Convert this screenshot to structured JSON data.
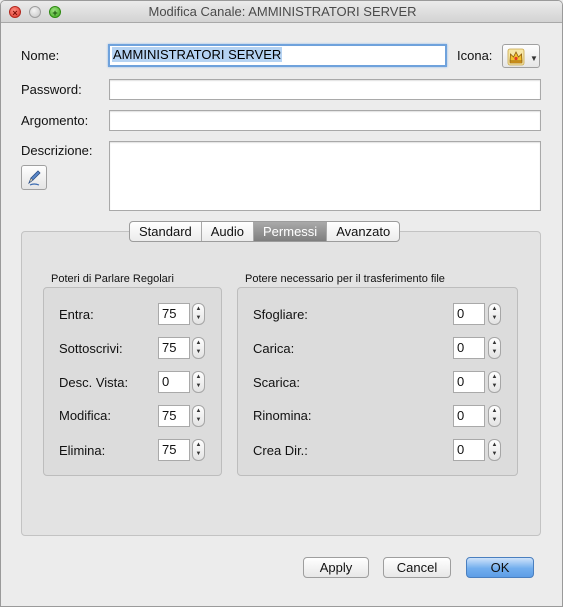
{
  "window": {
    "title": "Modifica Canale: AMMINISTRATORI SERVER"
  },
  "form": {
    "name_label": "Nome:",
    "name_value": "AMMINISTRATORI SERVER",
    "icon_label": "Icona:",
    "password_label": "Password:",
    "password_value": "",
    "topic_label": "Argomento:",
    "topic_value": "",
    "description_label": "Descrizione:",
    "description_value": ""
  },
  "tabs": [
    {
      "label": "Standard",
      "active": false
    },
    {
      "label": "Audio",
      "active": false
    },
    {
      "label": "Permessi",
      "active": true
    },
    {
      "label": "Avanzato",
      "active": false
    }
  ],
  "talk_powers": {
    "title": "Poteri di Parlare Regolari",
    "rows": [
      {
        "label": "Entra:",
        "value": "75"
      },
      {
        "label": "Sottoscrivi:",
        "value": "75"
      },
      {
        "label": "Desc. Vista:",
        "value": "0"
      },
      {
        "label": "Modifica:",
        "value": "75"
      },
      {
        "label": "Elimina:",
        "value": "75"
      }
    ]
  },
  "file_powers": {
    "title": "Potere necessario per il trasferimento file",
    "rows": [
      {
        "label": "Sfogliare:",
        "value": "0"
      },
      {
        "label": "Carica:",
        "value": "0"
      },
      {
        "label": "Scarica:",
        "value": "0"
      },
      {
        "label": "Rinomina:",
        "value": "0"
      },
      {
        "label": "Crea Dir.:",
        "value": "0"
      }
    ]
  },
  "buttons": {
    "apply": "Apply",
    "cancel": "Cancel",
    "ok": "OK"
  },
  "colors": {
    "accent": "#5d9de6",
    "selection": "#b5d3f3",
    "active_tab": "#8a8a8a"
  }
}
